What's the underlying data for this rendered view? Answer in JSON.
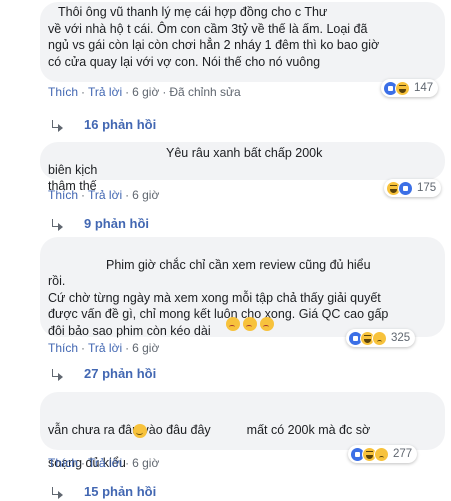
{
  "comments": [
    {
      "text": "Thôi ông vũ thanh lý mẹ cái hợp đồng cho c Thư\nvề với nhà hộ t cái. Ôm con cầm 3tỷ về thế là ấm. Loại đã\nngủ vs gái còn lại còn chơi hẳn 2 nháy 1 đêm thì ko bao giờ\ncó cửa quay lại với vợ con. Nói thế cho nó vuông",
      "like": "Thích",
      "reply": "Trả lời",
      "time": "6 giờ",
      "edited": "Đã chỉnh sửa",
      "reaction_count": "147",
      "replies": "16 phản hồi"
    },
    {
      "text": "Yêu râu xanh bất chấp 200k biên kịch\nthâm thế",
      "like": "Thích",
      "reply": "Trả lời",
      "time": "6 giờ",
      "reaction_count": "175",
      "replies": "9 phản hồi"
    },
    {
      "text": "Phim giờ chắc chỉ cần xem review cũng đủ hiểu\nrồi.\nCứ chờ từng ngày mà xem xong mỗi tập chả thấy giải quyết\nđược vấn đề gì, chỉ mong kết luôn cho xong. Giá QC cao gấp\nđôi bảo sao phim còn kéo dài",
      "like": "Thích",
      "reply": "Trả lời",
      "time": "6 giờ",
      "reaction_count": "325",
      "replies": "27 phản hồi"
    },
    {
      "text_line1a": "vẫn chưa ra đâu vào đâu đây",
      "text_line1b": "mất có 200k mà đc sờ",
      "text_line2": "soạng đủ kiểu",
      "like": "Thích",
      "reply": "Trả lời",
      "time": "6 giờ",
      "reaction_count": "277",
      "replies": "15 phản hồi"
    }
  ],
  "icons": {
    "reaction_like": "like-icon",
    "reaction_haha": "haha-icon",
    "reaction_sad": "sad-icon",
    "reply_arrow": "reply-arrow-icon"
  },
  "colors": {
    "bubble": "#f2f3f5",
    "link": "#4267b2",
    "meta": "#606770"
  }
}
